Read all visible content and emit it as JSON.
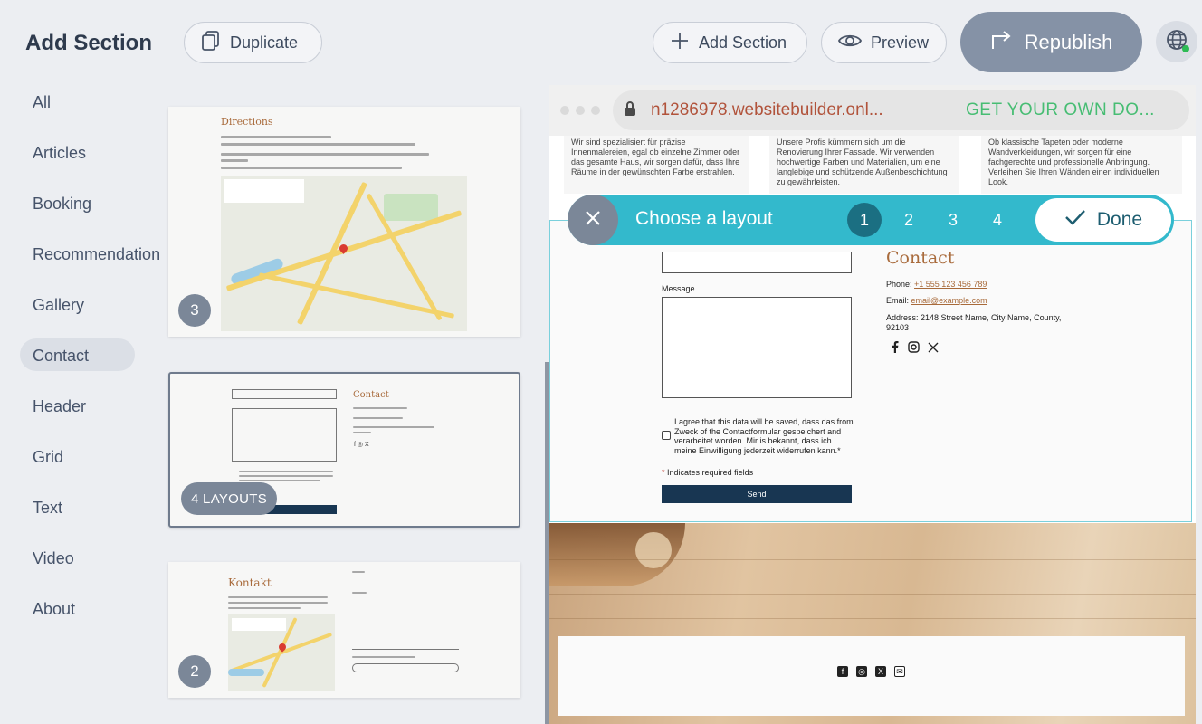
{
  "panel": {
    "title": "Add Section"
  },
  "toolbar": {
    "duplicate_label": "Duplicate",
    "add_section_label": "Add Section",
    "preview_label": "Preview",
    "republish_label": "Republish"
  },
  "categories": [
    "All",
    "Articles",
    "Booking",
    "Recommendation",
    "Gallery",
    "Contact",
    "Header",
    "Grid",
    "Text",
    "Video",
    "About"
  ],
  "active_category": "Contact",
  "thumbnails": [
    {
      "heading": "Directions",
      "badge": "3"
    },
    {
      "heading": "Contact",
      "badge": "4 LAYOUTS"
    },
    {
      "heading": "Kontakt",
      "badge": "2"
    }
  ],
  "browser": {
    "url": "n1286978.websitebuilder.onl...",
    "promo": "GET YOUR OWN DO..."
  },
  "top_strip": [
    "Wir sind spezialisiert für präzise Innenmalereien, egal ob einzelne Zimmer oder das gesamte Haus, wir sorgen dafür, dass Ihre Räume in der gewünschten Farbe erstrahlen.",
    "Unsere Profis kümmern sich um die Renovierung Ihrer Fassade. Wir verwenden hochwertige Farben und Materialien, um eine langlebige und schützende Außenbeschichtung zu gewährleisten.",
    "Ob klassische Tapeten oder moderne Wandverkleidungen, wir sorgen für eine fachgerechte und professionelle Anbringung. Verleihen Sie Ihren Wänden einen individuellen Look."
  ],
  "layout_chooser": {
    "title": "Choose a layout",
    "options": [
      "1",
      "2",
      "3",
      "4"
    ],
    "selected": "1",
    "done_label": "Done"
  },
  "contact_section": {
    "message_label": "Message",
    "consent_text": "I agree that this data will be saved, dass das from Zweck of the Contactformular gespeichert and verarbeitet worden. Mir is bekannt, dass ich meine Einwilligung jederzeit widerrufen kann.*",
    "required_note": "Indicates required fields",
    "required_mark": "*",
    "send_label": "Send",
    "heading": "Contact",
    "phone_label": "Phone: ",
    "phone": "+1 555 123 456 789",
    "email_label": "Email: ",
    "email": "email@example.com",
    "address": "Address: 2148 Street Name, City Name, County, 92103"
  },
  "colors": {
    "accent": "#33b9cc",
    "brand_heading": "#a96b3c",
    "republish_bg": "#8592a6",
    "send_bg": "#183652"
  },
  "icons": [
    "duplicate-icon",
    "plus-icon",
    "eye-icon",
    "republish-arrow-icon",
    "globe-icon",
    "lock-icon",
    "close-icon",
    "check-icon",
    "facebook-icon",
    "instagram-icon",
    "x-icon",
    "mail-icon"
  ]
}
